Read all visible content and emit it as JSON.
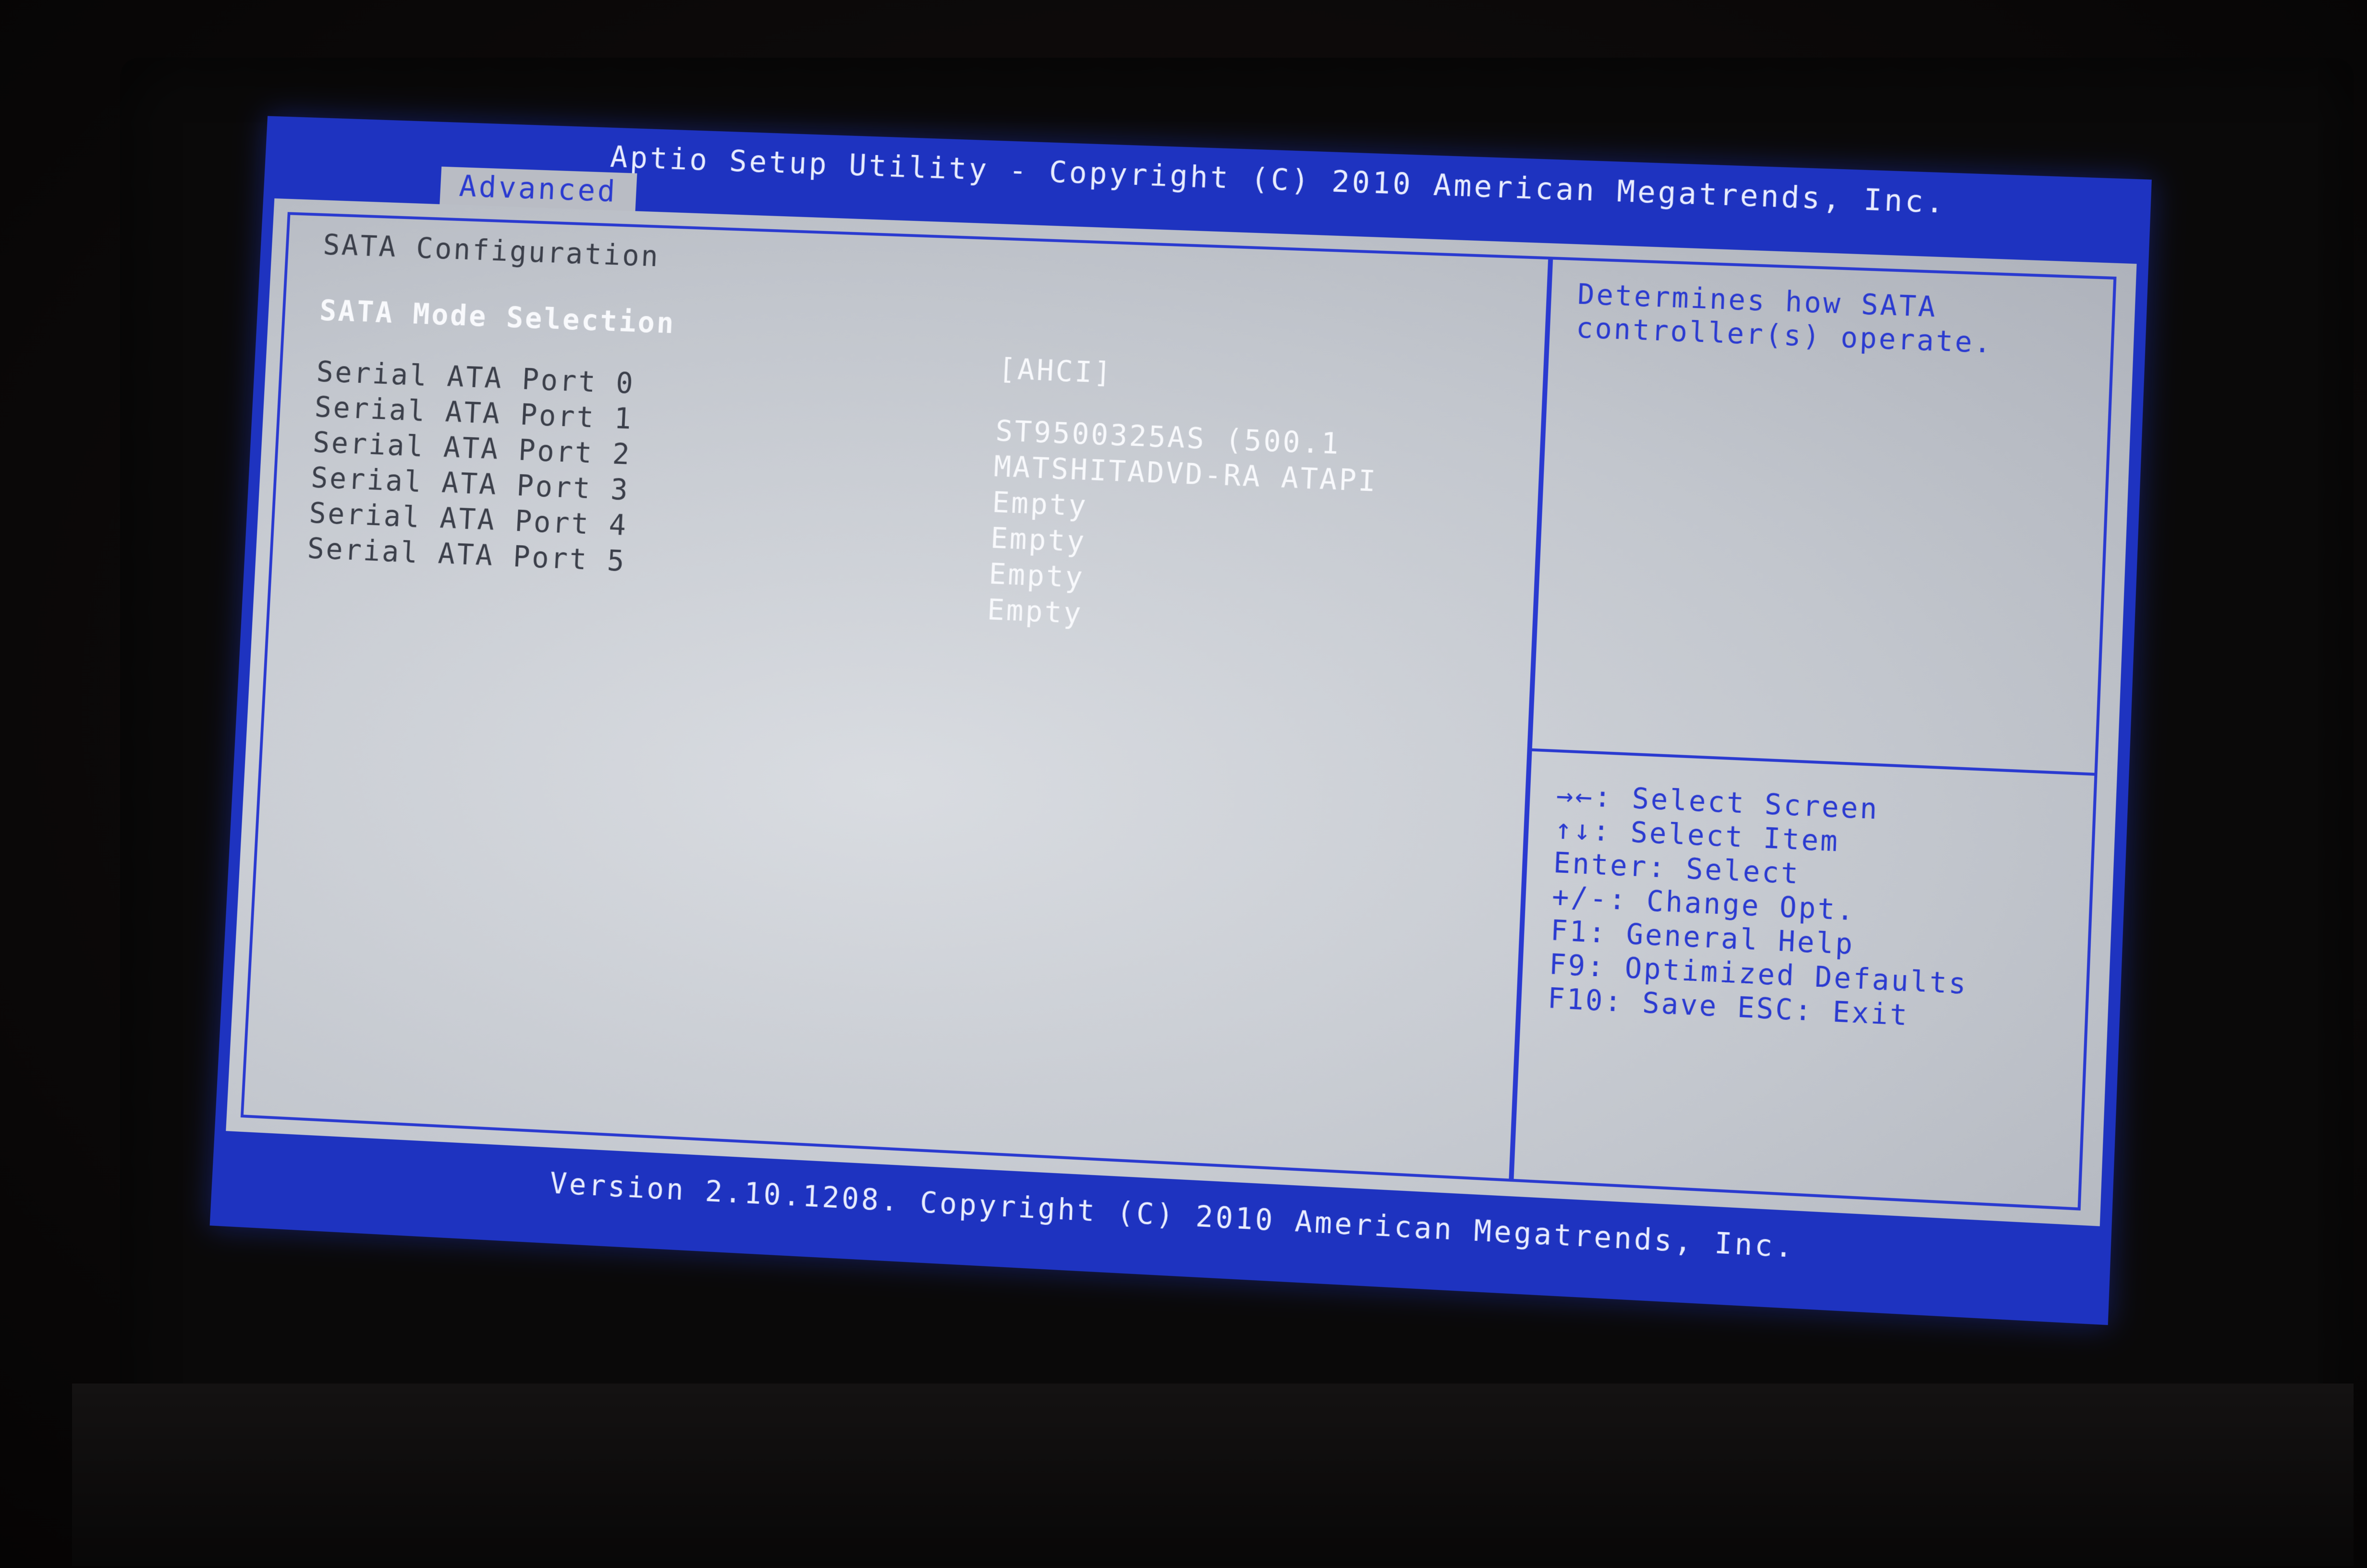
{
  "header": {
    "title": "Aptio Setup Utility - Copyright (C) 2010 American Megatrends, Inc.",
    "active_tab": "Advanced"
  },
  "main": {
    "section_title": "SATA Configuration",
    "mode_selection": {
      "label": "SATA Mode Selection",
      "value": "[AHCI]"
    },
    "ports": [
      {
        "label": "Serial ATA Port 0",
        "value": "ST9500325AS     (500.1"
      },
      {
        "label": "Serial ATA Port 1",
        "value": "MATSHITADVD-RA ATAPI"
      },
      {
        "label": "Serial ATA Port 2",
        "value": "Empty"
      },
      {
        "label": "Serial ATA Port 3",
        "value": "Empty"
      },
      {
        "label": "Serial ATA Port 4",
        "value": "Empty"
      },
      {
        "label": "Serial ATA Port 5",
        "value": "Empty"
      }
    ]
  },
  "help": {
    "description": [
      "Determines how SATA",
      "controller(s) operate."
    ],
    "keys": [
      "→←: Select Screen",
      "↑↓: Select Item",
      "Enter: Select",
      "+/-: Change Opt.",
      "F1: General Help",
      "F9: Optimized Defaults",
      "F10: Save  ESC: Exit"
    ]
  },
  "footer": {
    "text": "Version 2.10.1208. Copyright (C) 2010 American Megatrends, Inc."
  },
  "colors": {
    "bios_blue": "#1e33c0",
    "panel_gray": "#c2c6cd",
    "help_text_blue": "#2a3ad0",
    "highlight_white": "#f8f9fc"
  }
}
